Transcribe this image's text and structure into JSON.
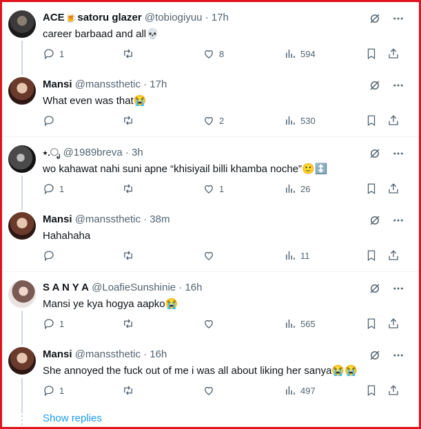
{
  "tweets": [
    {
      "name": "ACE🍺satoru glazer",
      "handle": "@tobiogiyuu",
      "time": "17h",
      "text": "career barbaad and all💀",
      "replies": "1",
      "retweets": "",
      "likes": "8",
      "views": "594"
    },
    {
      "name": "Mansi",
      "handle": "@manssthetic",
      "time": "17h",
      "text": "What even was that😭",
      "replies": "",
      "retweets": "",
      "likes": "2",
      "views": "530"
    },
    {
      "name": "⋆.ೃ",
      "handle": "@1989breva",
      "time": "3h",
      "text": "wo kahawat nahi suni apne “khisiyail billi khamba noche”🙂↕️",
      "replies": "1",
      "retweets": "",
      "likes": "1",
      "views": "26"
    },
    {
      "name": "Mansi",
      "handle": "@manssthetic",
      "time": "38m",
      "text": "Hahahaha",
      "replies": "",
      "retweets": "",
      "likes": "",
      "views": "11"
    },
    {
      "name": "S A N Y A",
      "handle": "@LoafieSunshinie",
      "time": "16h",
      "text": "Mansi ye kya hogya aapko😭",
      "replies": "1",
      "retweets": "",
      "likes": "",
      "views": "565"
    },
    {
      "name": "Mansi",
      "handle": "@manssthetic",
      "time": "16h",
      "text": "She annoyed the fuck out of me i was all about liking her sanya😭😭",
      "replies": "1",
      "retweets": "",
      "likes": "",
      "views": "497"
    }
  ],
  "show_replies": "Show replies",
  "separator": "·",
  "colors": {
    "link": "#1d9bf0",
    "muted": "#536471",
    "frame": "#e0141e"
  }
}
